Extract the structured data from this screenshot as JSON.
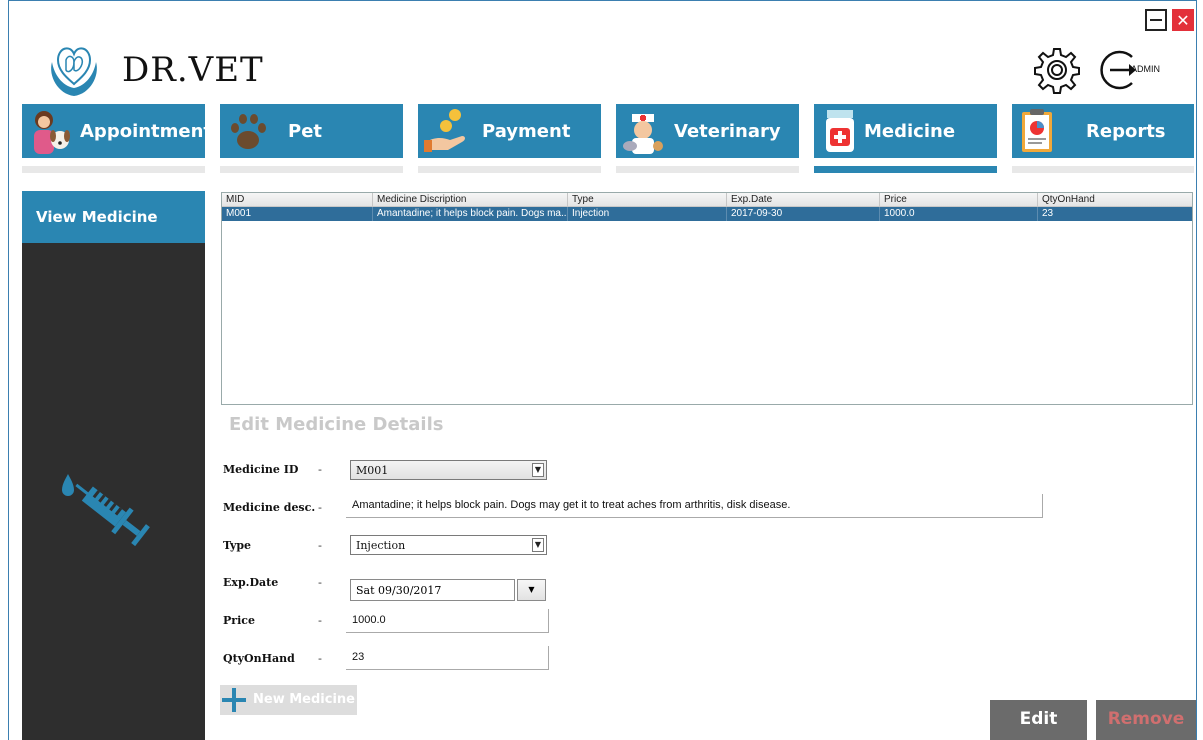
{
  "app": {
    "title": "DR.VET",
    "admin_label": "ADMIN"
  },
  "colors": {
    "accent": "#2a86b2",
    "sidebar": "#2e2e2e",
    "selected_row": "#2f6d9a",
    "close": "#e3303a"
  },
  "window": {
    "minimize_icon": "minimize-icon",
    "close_icon": "close-icon",
    "close_label": "✕"
  },
  "nav": {
    "tabs": [
      {
        "label": "Appointment",
        "icon": "appointment-icon"
      },
      {
        "label": "Pet",
        "icon": "paw-icon"
      },
      {
        "label": "Payment",
        "icon": "payment-icon"
      },
      {
        "label": "Veterinary",
        "icon": "veterinary-icon"
      },
      {
        "label": "Medicine",
        "icon": "medicine-icon",
        "active": true
      },
      {
        "label": "Reports",
        "icon": "reports-icon"
      }
    ]
  },
  "sidebar": {
    "items": [
      {
        "label": "View Medicine"
      }
    ],
    "icon": "syringe-icon"
  },
  "table": {
    "columns": [
      "MID",
      "Medicine Discription",
      "Type",
      "Exp.Date",
      "Price",
      "QtyOnHand"
    ],
    "rows": [
      [
        "M001",
        "Amantadine; it helps block pain. Dogs ma...",
        "Injection",
        "2017-09-30",
        "1000.0",
        "23"
      ]
    ]
  },
  "form": {
    "title": "Edit Medicine Details",
    "dash": "-",
    "medicine_id": {
      "label": "Medicine ID",
      "value": "M001"
    },
    "medicine_desc": {
      "label": "Medicine desc.",
      "value": "Amantadine; it helps block pain. Dogs may get it to treat aches from arthritis, disk disease."
    },
    "type": {
      "label": "Type",
      "value": "Injection"
    },
    "exp_date": {
      "label": "Exp.Date",
      "value": "Sat 09/30/2017"
    },
    "price": {
      "label": "Price",
      "value": "1000.0"
    },
    "qty": {
      "label": "QtyOnHand",
      "value": "23"
    }
  },
  "buttons": {
    "new_medicine": "New Medicine",
    "edit": "Edit",
    "remove": "Remove"
  }
}
